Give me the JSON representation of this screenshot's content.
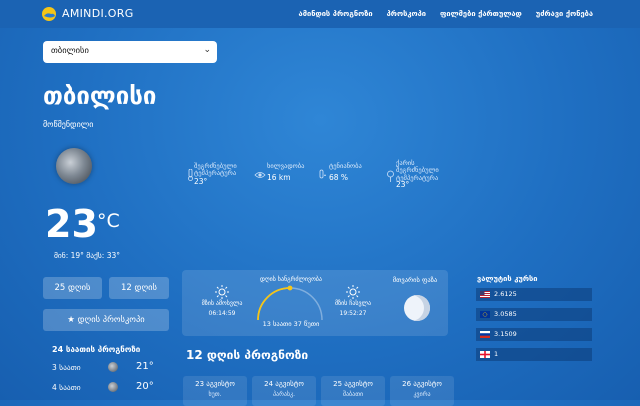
{
  "header": {
    "logo_text": "AMINDI.ORG",
    "nav": [
      "ამინდის პროგნოზი",
      "პროსკოპი",
      "ფილმები ქართულად",
      "უძრავი ქონება"
    ]
  },
  "city_select": {
    "value": "თბილისი"
  },
  "city": {
    "title": "თბილისი",
    "subtitle": "მოწმენდილი"
  },
  "current": {
    "temp": "23",
    "unit": "°C",
    "minmax": "მინ: 19°  მაქს: 33°"
  },
  "stats": [
    {
      "label1": "შეგრძნებული",
      "label2": "ტემპერატურა",
      "value": "23°"
    },
    {
      "label1": "ხილვადობა",
      "label2": "",
      "value": "16 km"
    },
    {
      "label1": "ტენიანობა",
      "label2": "",
      "value": "68 %"
    },
    {
      "label1": "ქარის",
      "label2": "შეგრძნებული",
      "label3": "ტემპერატურა",
      "value": "23°"
    }
  ],
  "buttons": {
    "days25": "25 დღის",
    "days12": "12 დღის",
    "long": "დღის პროსკოპი"
  },
  "hourly": {
    "title": "24 საათის პროგნოზი",
    "rows": [
      {
        "hour": "3 საათი",
        "temp": "21°"
      },
      {
        "hour": "4 საათი",
        "temp": "20°"
      }
    ]
  },
  "astro": {
    "sunrise_label": "მზის ამოსვლა",
    "sunrise_time": "06:14:59",
    "day_label": "დღის ხანგრძლივობა",
    "day_length": "13 საათი 37 წუთი",
    "sunset_label": "მზის ჩასვლა",
    "sunset_time": "19:52:27",
    "phase_label": "მთვარის ფაზა",
    "colors": {
      "sun": "#f5c518",
      "arc": "#f5c518"
    }
  },
  "forecast": {
    "title": "12 დღის პროგნოზი",
    "days": [
      {
        "date": "23 აგვისტო",
        "weekday": "ხუთ."
      },
      {
        "date": "24 აგვისტო",
        "weekday": "პარასკ."
      },
      {
        "date": "25 აგვისტო",
        "weekday": "შაბათი"
      },
      {
        "date": "26 აგვისტო",
        "weekday": "კვირა"
      }
    ]
  },
  "fx": {
    "title": "ვალუტის კურსი",
    "rows": [
      {
        "flag": "us-flag",
        "value": "2.6125"
      },
      {
        "flag": "eu-flag",
        "value": "3.0585"
      },
      {
        "flag": "ru-flag",
        "value": "3.1509"
      },
      {
        "flag": "ge-flag",
        "value": "1"
      }
    ]
  }
}
